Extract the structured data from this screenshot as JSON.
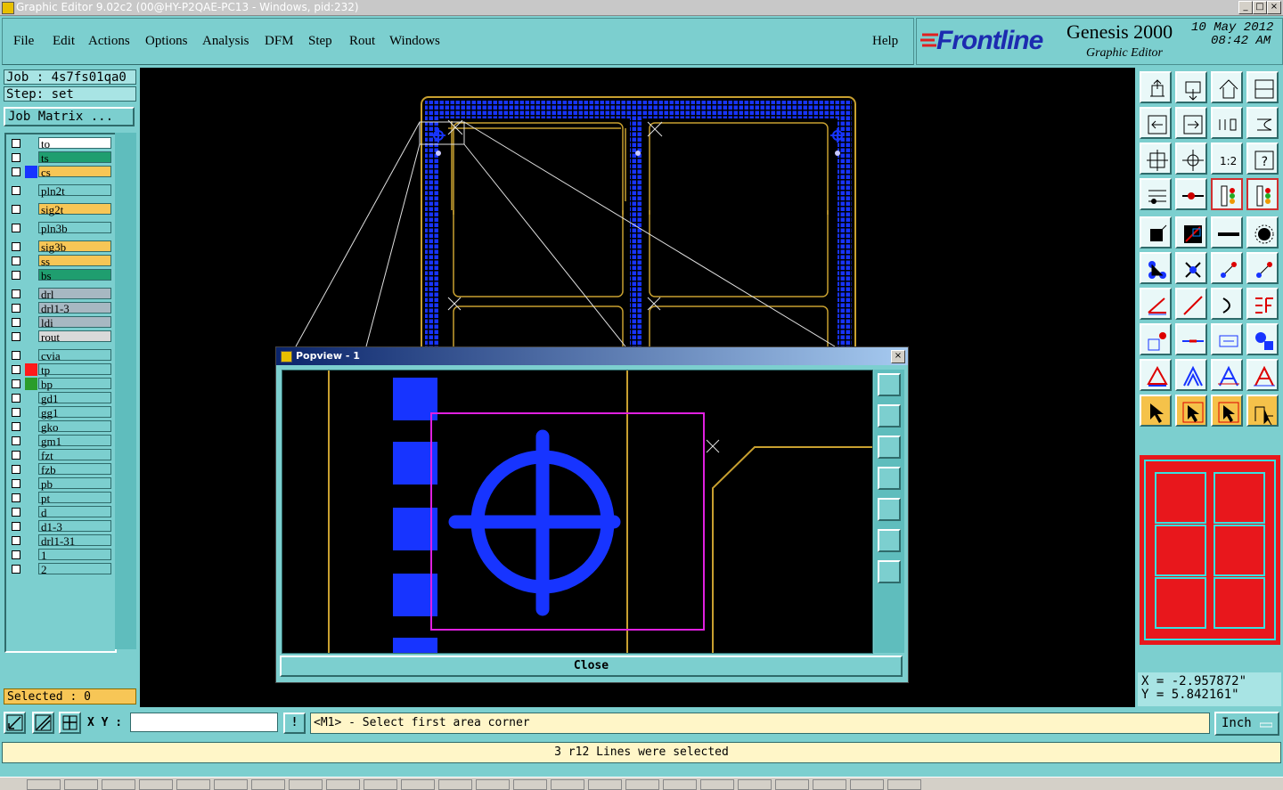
{
  "window": {
    "title": "Graphic Editor 9.02c2 (00@HY-P2QAE-PC13 - Windows, pid:232)",
    "min_label": "_",
    "max_label": "□",
    "close_label": "×"
  },
  "menu": {
    "items": [
      "File",
      "Edit",
      "Actions",
      "Options",
      "Analysis",
      "DFM",
      "Step",
      "Rout",
      "Windows"
    ],
    "help": "Help"
  },
  "brand": {
    "logo": "Frontline",
    "product": "Genesis 2000",
    "subtitle": "Graphic Editor",
    "date": "10 May 2012",
    "time": "08:42 AM"
  },
  "job": {
    "job_label": "Job : 4s7fs01qa0",
    "step_label": "Step: set",
    "matrix_button": "Job Matrix ...",
    "selected": "Selected : 0"
  },
  "layers": [
    {
      "name": "to",
      "color": "#ffffff",
      "swatch": ""
    },
    {
      "name": "ts",
      "color": "#1f9e6f",
      "swatch": ""
    },
    {
      "name": "cs",
      "color": "#f7c656",
      "swatch": "#1734ff"
    },
    {
      "name": "pln2t",
      "color": "#7ccfcf",
      "swatch": ""
    },
    {
      "name": "sig2t",
      "color": "#f7c656",
      "swatch": ""
    },
    {
      "name": "pln3b",
      "color": "#7ccfcf",
      "swatch": ""
    },
    {
      "name": "sig3b",
      "color": "#f7c656",
      "swatch": ""
    },
    {
      "name": "ss",
      "color": "#f7c656",
      "swatch": ""
    },
    {
      "name": "bs",
      "color": "#1f9e6f",
      "swatch": ""
    },
    {
      "name": "drl",
      "color": "#a7b8c2",
      "swatch": ""
    },
    {
      "name": "drl1-3",
      "color": "#a7b8c2",
      "swatch": ""
    },
    {
      "name": "ldi",
      "color": "#a7b8c2",
      "swatch": ""
    },
    {
      "name": "rout",
      "color": "#d9d9d9",
      "swatch": ""
    },
    {
      "name": "cvia",
      "color": "#7ccfcf",
      "swatch": ""
    },
    {
      "name": "tp",
      "color": "#7ccfcf",
      "swatch": "#ff1a1a"
    },
    {
      "name": "bp",
      "color": "#7ccfcf",
      "swatch": "#2a9d2a"
    },
    {
      "name": "gd1",
      "color": "#7ccfcf",
      "swatch": ""
    },
    {
      "name": "gg1",
      "color": "#7ccfcf",
      "swatch": ""
    },
    {
      "name": "gko",
      "color": "#7ccfcf",
      "swatch": ""
    },
    {
      "name": "gm1",
      "color": "#7ccfcf",
      "swatch": ""
    },
    {
      "name": "fzt",
      "color": "#7ccfcf",
      "swatch": ""
    },
    {
      "name": "fzb",
      "color": "#7ccfcf",
      "swatch": ""
    },
    {
      "name": "pb",
      "color": "#7ccfcf",
      "swatch": ""
    },
    {
      "name": "pt",
      "color": "#7ccfcf",
      "swatch": ""
    },
    {
      "name": "d",
      "color": "#7ccfcf",
      "swatch": ""
    },
    {
      "name": "d1-3",
      "color": "#7ccfcf",
      "swatch": ""
    },
    {
      "name": "drl1-31",
      "color": "#7ccfcf",
      "swatch": ""
    },
    {
      "name": "1",
      "color": "#7ccfcf",
      "swatch": ""
    },
    {
      "name": "2",
      "color": "#7ccfcf",
      "swatch": ""
    }
  ],
  "popview": {
    "title": "Popview - 1",
    "close_button": "Close"
  },
  "coords": {
    "x": "X = -2.957872\"",
    "y": "Y = 5.842161\""
  },
  "command": {
    "xy_label": "X Y :",
    "xy_value": "",
    "prompt_icon": "!",
    "prompt": "<M1> - Select first area corner",
    "unit": "Inch"
  },
  "status": "3 r12 Lines were selected",
  "colors": {
    "panel": "#7ccfcf",
    "pad": "#1734ff",
    "outline": "#c8a030",
    "frame": "#e0e0e0",
    "selection": "#e020e0",
    "overview": "#e8171c",
    "overview_lines": "#38e0e0"
  }
}
